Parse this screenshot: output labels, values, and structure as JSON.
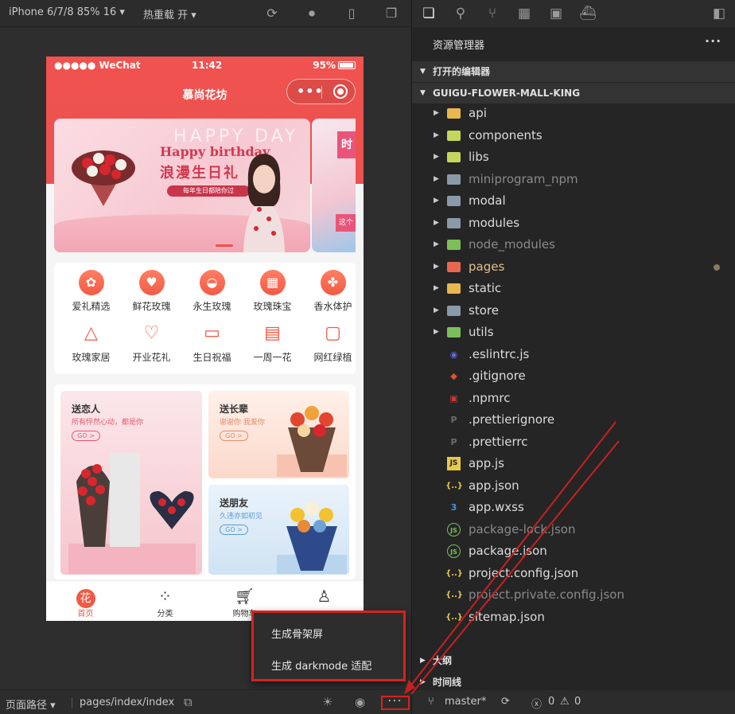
{
  "simulator": {
    "device_label": "iPhone 6/7/8 85% 16 ▾",
    "hot_reload_label": "热重载 开 ▾",
    "phone": {
      "status": {
        "carrier": "●●●●● WeChat",
        "time": "11:42",
        "battery": "95%"
      },
      "nav_title": "慕尚花坊",
      "banner": {
        "ghost_text": "HAPPY  DAY",
        "headline": "Happy birthday",
        "subhead": "浪漫生日礼",
        "ribbon": "每年生日都陪你过",
        "next_tag": "时",
        "next_tag2": "这个"
      },
      "categories": [
        {
          "label": "爱礼精选",
          "icon": "heart-flower-icon"
        },
        {
          "label": "鲜花玫瑰",
          "icon": "shopping-bag-icon"
        },
        {
          "label": "永生玫瑰",
          "icon": "cake-icon"
        },
        {
          "label": "玫瑰珠宝",
          "icon": "gift-icon"
        },
        {
          "label": "香水体护",
          "icon": "clover-icon"
        },
        {
          "label": "玫瑰家居",
          "icon": "party-hat-icon"
        },
        {
          "label": "开业花礼",
          "icon": "heart-outline-icon"
        },
        {
          "label": "生日祝福",
          "icon": "briefcase-icon"
        },
        {
          "label": "一周一花",
          "icon": "calendar-icon"
        },
        {
          "label": "网红绿植",
          "icon": "note-icon"
        }
      ],
      "promos": [
        {
          "title": "送恋人",
          "subtitle": "所有怦然心动，都是你",
          "go": "GO >",
          "accent": "#e8576d"
        },
        {
          "title": "送长辈",
          "subtitle": "谢谢你 我爱你",
          "go": "GO >",
          "accent": "#e88a6d"
        },
        {
          "title": "送朋友",
          "subtitle": "久违亦如初见",
          "go": "GO >",
          "accent": "#5b9bd5"
        }
      ],
      "tabs": [
        {
          "label": "首页",
          "icon": "home-icon"
        },
        {
          "label": "分类",
          "icon": "category-icon"
        },
        {
          "label": "购物车",
          "icon": "cart-icon"
        },
        {
          "label": "",
          "icon": "user-icon"
        }
      ]
    },
    "popup_menu": [
      "生成骨架屏",
      "生成 darkmode 适配"
    ],
    "bottom": {
      "page_path_label": "页面路径 ▾",
      "page_path": "pages/index/index",
      "more": "···"
    }
  },
  "explorer": {
    "title": "资源管理器",
    "more": "···",
    "sections": {
      "open_editors": "打开的编辑器",
      "project": "GUIGU-FLOWER-MALL-KING",
      "outline": "大纲",
      "timeline": "时间线"
    },
    "items": [
      {
        "name": "api",
        "type": "folder",
        "color": "#e8b84f",
        "state": "normal"
      },
      {
        "name": "components",
        "type": "folder",
        "color": "#c5d65b",
        "state": "normal"
      },
      {
        "name": "libs",
        "type": "folder",
        "color": "#c5d65b",
        "state": "normal"
      },
      {
        "name": "miniprogram_npm",
        "type": "folder",
        "color": "#8a9aa8",
        "state": "dim"
      },
      {
        "name": "modal",
        "type": "folder",
        "color": "#8a9aa8",
        "state": "normal"
      },
      {
        "name": "modules",
        "type": "folder",
        "color": "#8a9aa8",
        "state": "normal"
      },
      {
        "name": "node_modules",
        "type": "folder",
        "color": "#7cbf5a",
        "state": "dim"
      },
      {
        "name": "pages",
        "type": "folder",
        "color": "#e8674f",
        "state": "dirty"
      },
      {
        "name": "static",
        "type": "folder",
        "color": "#e8b84f",
        "state": "normal"
      },
      {
        "name": "store",
        "type": "folder",
        "color": "#8a9aa8",
        "state": "normal"
      },
      {
        "name": "utils",
        "type": "folder",
        "color": "#7cbf5a",
        "state": "normal"
      },
      {
        "name": ".eslintrc.js",
        "type": "file",
        "icon_text": "◉",
        "color": "#5a6cd8",
        "state": "normal"
      },
      {
        "name": ".gitignore",
        "type": "file",
        "icon_text": "◆",
        "color": "#e0532f",
        "state": "normal"
      },
      {
        "name": ".npmrc",
        "type": "file",
        "icon_text": "▣",
        "color": "#cb3837",
        "state": "normal"
      },
      {
        "name": ".prettierignore",
        "type": "file",
        "icon_text": "P",
        "color": "#6d6d6d",
        "state": "normal"
      },
      {
        "name": ".prettierrc",
        "type": "file",
        "icon_text": "P",
        "color": "#6d6d6d",
        "state": "normal"
      },
      {
        "name": "app.js",
        "type": "file",
        "icon_text": "JS",
        "color": "#e8c84a",
        "state": "normal"
      },
      {
        "name": "app.json",
        "type": "file",
        "icon_text": "{..}",
        "color": "#e8c84a",
        "state": "normal"
      },
      {
        "name": "app.wxss",
        "type": "file",
        "icon_text": "3",
        "color": "#4a90d9",
        "state": "normal"
      },
      {
        "name": "package-lock.json",
        "type": "file",
        "icon_text": "JS",
        "color": "#7cbf5a",
        "state": "dim"
      },
      {
        "name": "package.json",
        "type": "file",
        "icon_text": "JS",
        "color": "#7cbf5a",
        "state": "normal"
      },
      {
        "name": "project.config.json",
        "type": "file",
        "icon_text": "{..}",
        "color": "#e8c84a",
        "state": "normal"
      },
      {
        "name": "project.private.config.json",
        "type": "file",
        "icon_text": "{..}",
        "color": "#e8c84a",
        "state": "dim"
      },
      {
        "name": "sitemap.json",
        "type": "file",
        "icon_text": "{..}",
        "color": "#e8c84a",
        "state": "normal"
      }
    ],
    "status": {
      "branch": "master*",
      "errors": "0",
      "warnings": "0"
    }
  },
  "colors": {
    "brand_red": "#ec5250",
    "highlight_red": "#d6231f"
  }
}
